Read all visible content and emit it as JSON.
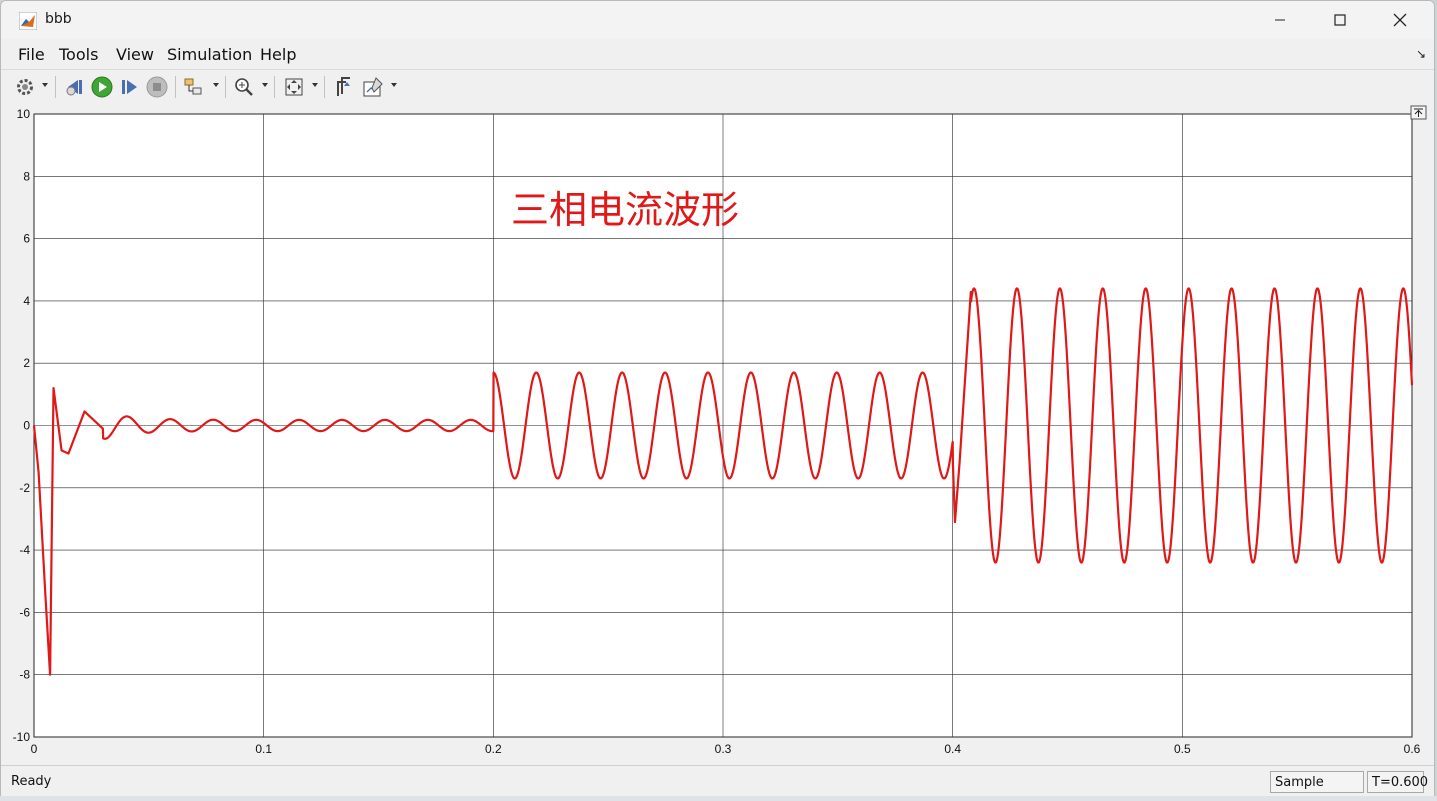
{
  "window": {
    "title": "bbb",
    "controls": [
      "minimize",
      "maximize",
      "close"
    ]
  },
  "menu": {
    "items": [
      {
        "label": "File",
        "key": "F"
      },
      {
        "label": "Tools",
        "key": "T"
      },
      {
        "label": "View",
        "key": "V"
      },
      {
        "label": "Simulation",
        "key": "i"
      },
      {
        "label": "Help",
        "key": "H"
      }
    ]
  },
  "toolbar": {
    "icons": [
      "settings-gear-icon",
      "step-back-icon",
      "run-icon",
      "step-forward-icon",
      "stop-icon",
      "highlight-block-icon",
      "zoom-icon",
      "fit-to-view-icon",
      "cursor-measurements-icon",
      "style-icon"
    ]
  },
  "colors": {
    "signal": "#e01818",
    "grid": "#262626",
    "annotation": "#e01818",
    "plot_background": "#ffffff"
  },
  "annotation_text": "三相电流波形",
  "status": {
    "ready": "Ready",
    "mode": "Sample based",
    "time": "T=0.600"
  },
  "chart_data": {
    "type": "line",
    "title": "",
    "xlabel": "",
    "ylabel": "",
    "xlim": [
      0,
      0.6
    ],
    "ylim": [
      -10,
      10
    ],
    "xticks": [
      0,
      0.1,
      0.2,
      0.3,
      0.4,
      0.5,
      0.6
    ],
    "yticks": [
      -10,
      -8,
      -6,
      -4,
      -2,
      0,
      2,
      4,
      6,
      8,
      10
    ],
    "xtick_labels": [
      "0",
      "0.1",
      "0.2",
      "0.3",
      "0.4",
      "0.5",
      "0.6"
    ],
    "ytick_labels": [
      "-10",
      "-8",
      "-6",
      "-4",
      "-2",
      "0",
      "2",
      "4",
      "6",
      "8",
      "10"
    ],
    "grid": true,
    "series": [
      {
        "segments": [
          {
            "x_start": 0,
            "x_end": 0.2,
            "frequency_hz": 53.5,
            "amplitude": 0.18,
            "transient": [
              [
                0,
                0
              ],
              [
                0.002,
                -1.5
              ],
              [
                0.005,
                -5.5
              ],
              [
                0.007,
                -8.0
              ],
              [
                0.0085,
                1.2
              ],
              [
                0.012,
                -0.8
              ],
              [
                0.015,
                -0.9
              ],
              [
                0.022,
                0.45
              ],
              [
                0.03,
                -0.1
              ]
            ]
          },
          {
            "x_start": 0.2,
            "x_end": 0.4,
            "frequency_hz": 53.5,
            "amplitude": 1.7
          },
          {
            "x_start": 0.4,
            "x_end": 0.6,
            "frequency_hz": 53.5,
            "amplitude": 4.4,
            "transient": [
              [
                0.4,
                -1.0
              ],
              [
                0.401,
                -3.1
              ],
              [
                0.403,
                -1.2
              ]
            ]
          }
        ],
        "key_points": [
          [
            0,
            0
          ],
          [
            0.007,
            -8.0
          ],
          [
            0.0085,
            1.2
          ],
          [
            0.022,
            0.45
          ],
          [
            0.2,
            1.7
          ],
          [
            0.401,
            -3.1
          ],
          [
            0.408,
            4.4
          ],
          [
            0.6,
            0.45
          ]
        ]
      }
    ]
  }
}
